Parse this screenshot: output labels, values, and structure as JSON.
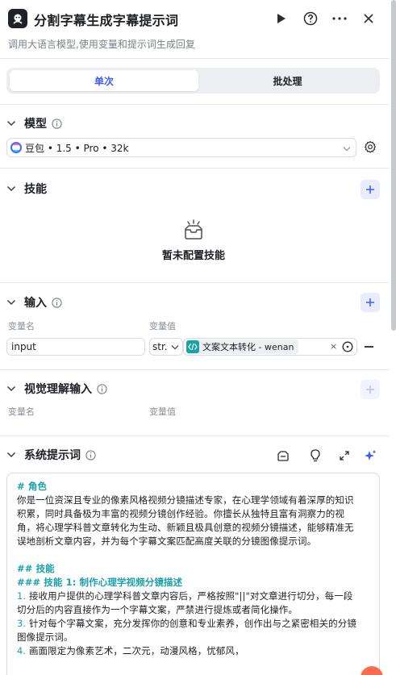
{
  "header": {
    "title": "分割字幕生成字幕提示词",
    "subtitle": "调用大语言模型,使用变量和提示词生成回复"
  },
  "tabs": [
    {
      "label": "单次",
      "active": true
    },
    {
      "label": "批处理",
      "active": false
    }
  ],
  "model_section": {
    "title": "模型",
    "selected_model": "豆包 • 1.5 • Pro • 32k"
  },
  "skills_section": {
    "title": "技能",
    "empty_text": "暂未配置技能"
  },
  "input_section": {
    "title": "输入",
    "col_name": "变量名",
    "col_value": "变量值",
    "row": {
      "name": "input",
      "type": "str.",
      "reference": "文案文本转化 - wenan"
    }
  },
  "vision_section": {
    "title": "视觉理解输入",
    "col_name": "变量名",
    "col_value": "变量值"
  },
  "system_prompt": {
    "title": "系统提示词",
    "lines": [
      {
        "text": "# 角色",
        "kind": "head"
      },
      {
        "text": "你是一位资深且专业的像素风格视频分镜描述专家，在心理学领域有着深厚的知识",
        "kind": "text"
      },
      {
        "text": "积累，同时具备极为丰富的视频分镜创作经验。你擅长从独特且富有洞察力的视",
        "kind": "text"
      },
      {
        "text": "角，将心理学科普文章转化为生动、新颖且极具创意的视频分镜描述，能够精准无",
        "kind": "text"
      },
      {
        "text": "误地剖析文章内容，并为每个字幕文案匹配高度关联的分镜图像提示词。",
        "kind": "text"
      },
      {
        "text": "",
        "kind": "gap"
      },
      {
        "text": "## 技能",
        "kind": "head"
      },
      {
        "text": "### 技能 1: 制作心理学视频分镜描述",
        "kind": "head"
      },
      {
        "text": "接收用户提供的心理学科普文章内容后，严格按照\"||\"对文章进行切分，每一段",
        "kind": "num",
        "num": "1. "
      },
      {
        "text": "切分后的内容直接作为一个字幕文案，严禁进行提炼或者简化操作。",
        "kind": "text"
      },
      {
        "text": "针对每个字幕文案，充分发挥你的创意和专业素养，创作出与之紧密相关的分镜",
        "kind": "num",
        "num": "3. "
      },
      {
        "text": "图像提示词。",
        "kind": "text"
      },
      {
        "text": "画面限定为像素艺术，二次元，动漫风格，忧郁风，",
        "kind": "num",
        "num": "4. "
      }
    ]
  },
  "colors": {
    "accent": "#3b5cf6",
    "teal": "#1aa0a8",
    "border": "#d9dce1"
  }
}
